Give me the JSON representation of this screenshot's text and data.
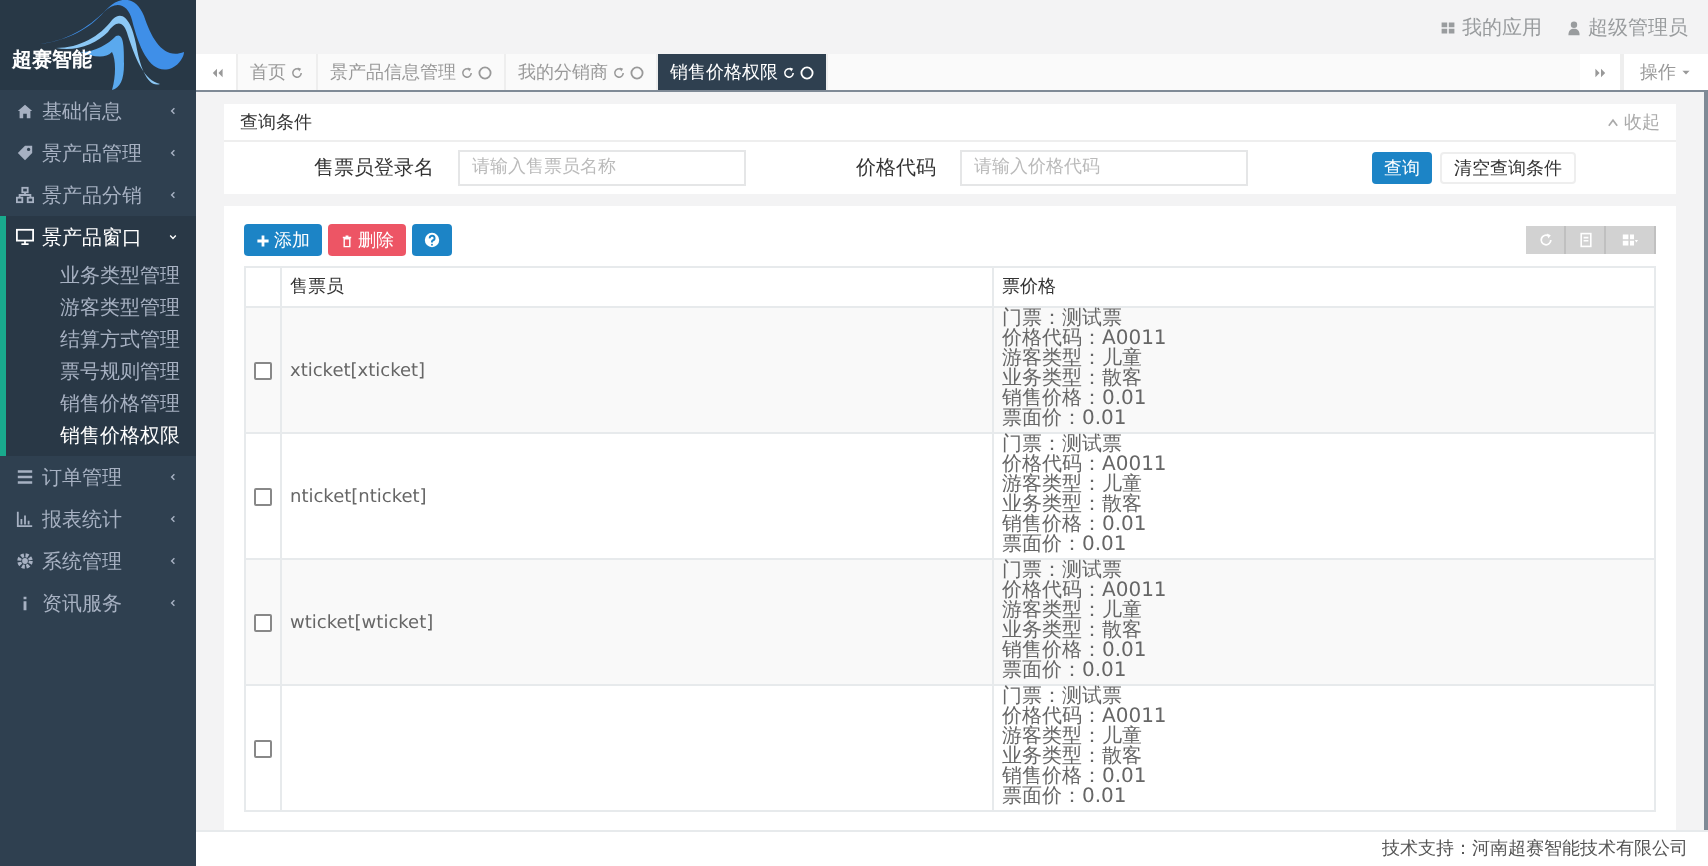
{
  "logo": {
    "text": "超赛智能"
  },
  "sidebar": {
    "items": [
      {
        "label": "基础信息",
        "expanded": false
      },
      {
        "label": "景产品管理",
        "expanded": false
      },
      {
        "label": "景产品分销",
        "expanded": false
      },
      {
        "label": "景产品窗口",
        "expanded": true,
        "children": [
          {
            "label": "业务类型管理",
            "selected": false
          },
          {
            "label": "游客类型管理",
            "selected": false
          },
          {
            "label": "结算方式管理",
            "selected": false
          },
          {
            "label": "票号规则管理",
            "selected": false
          },
          {
            "label": "销售价格管理",
            "selected": false
          },
          {
            "label": "销售价格权限",
            "selected": true
          }
        ]
      },
      {
        "label": "订单管理",
        "expanded": false
      },
      {
        "label": "报表统计",
        "expanded": false
      },
      {
        "label": "系统管理",
        "expanded": false
      },
      {
        "label": "资讯服务",
        "expanded": false
      }
    ]
  },
  "header": {
    "apps": "我的应用",
    "user": "超级管理员"
  },
  "tabs": [
    {
      "label": "首页",
      "closable": false,
      "selected": false
    },
    {
      "label": "景产品信息管理",
      "closable": true,
      "selected": false
    },
    {
      "label": "我的分销商",
      "closable": true,
      "selected": false
    },
    {
      "label": "销售价格权限",
      "closable": true,
      "selected": true
    }
  ],
  "tab_menu": {
    "label": "操作"
  },
  "query": {
    "title": "查询条件",
    "collapse": "收起",
    "fields": [
      {
        "label": "售票员登录名",
        "placeholder": "请输入售票员名称"
      },
      {
        "label": "价格代码",
        "placeholder": "请输入价格代码"
      }
    ],
    "search": "查询",
    "clear": "清空查询条件"
  },
  "toolbar": {
    "add": "添加",
    "delete": "删除"
  },
  "table": {
    "columns": [
      "售票员",
      "票价格"
    ],
    "rows": [
      {
        "checked": false,
        "seller": "xticket[xticket]",
        "price_lines": [
          "门票：测试票",
          "价格代码：A0011",
          "游客类型：儿童",
          "业务类型：散客",
          "销售价格：0.01",
          "票面价：0.01"
        ]
      },
      {
        "checked": false,
        "seller": "nticket[nticket]",
        "price_lines": [
          "门票：测试票",
          "价格代码：A0011",
          "游客类型：儿童",
          "业务类型：散客",
          "销售价格：0.01",
          "票面价：0.01"
        ]
      },
      {
        "checked": false,
        "seller": "wticket[wticket]",
        "price_lines": [
          "门票：测试票",
          "价格代码：A0011",
          "游客类型：儿童",
          "业务类型：散客",
          "销售价格：0.01",
          "票面价：0.01"
        ]
      },
      {
        "checked": false,
        "seller": "",
        "price_lines": [
          "门票：测试票",
          "价格代码：A0011",
          "游客类型：儿童",
          "业务类型：散客",
          "销售价格：0.01",
          "票面价：0.01"
        ]
      }
    ]
  },
  "footer": {
    "text": "技术支持：河南超赛智能技术有限公司"
  }
}
